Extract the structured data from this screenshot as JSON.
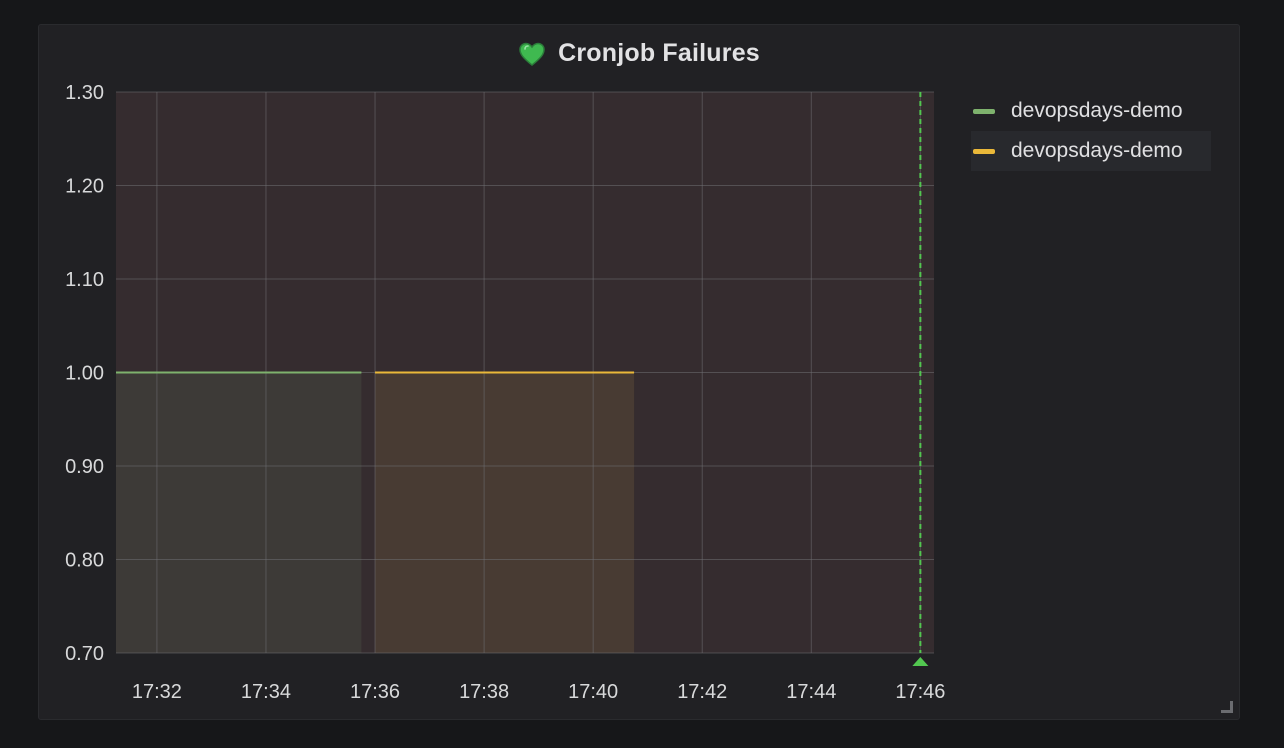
{
  "panel": {
    "title": "Cronjob Failures",
    "icon": "heart-icon",
    "status_color": "#3fb950"
  },
  "colors": {
    "background": "#161719",
    "panel": "#212124",
    "plot_bg": "#352c2f",
    "grid": "#6e6e72",
    "axis_text": "#d8d9da",
    "now_marker": "#52c750"
  },
  "chart_data": {
    "type": "area",
    "title": "Cronjob Failures",
    "xlabel": "",
    "ylabel": "",
    "x_ticks": [
      "17:32",
      "17:34",
      "17:36",
      "17:38",
      "17:40",
      "17:42",
      "17:44",
      "17:46"
    ],
    "y_ticks": [
      "0.70",
      "0.80",
      "0.90",
      "1.00",
      "1.10",
      "1.20",
      "1.30"
    ],
    "xlim": [
      "17:31:15",
      "17:46:15"
    ],
    "ylim": [
      0.7,
      1.3
    ],
    "grid": true,
    "legend_position": "right",
    "now_marker": "17:46",
    "series": [
      {
        "name": "devopsdays-demo",
        "color": "#7eb26d",
        "fill": "#3d3a37",
        "points": [
          {
            "x": "17:31:15",
            "y": 1.0
          },
          {
            "x": "17:35:45",
            "y": 1.0
          }
        ]
      },
      {
        "name": "devopsdays-demo",
        "color": "#eab839",
        "fill": "#483b33",
        "points": [
          {
            "x": "17:36",
            "y": 1.0
          },
          {
            "x": "17:40:45",
            "y": 1.0
          }
        ]
      }
    ]
  }
}
